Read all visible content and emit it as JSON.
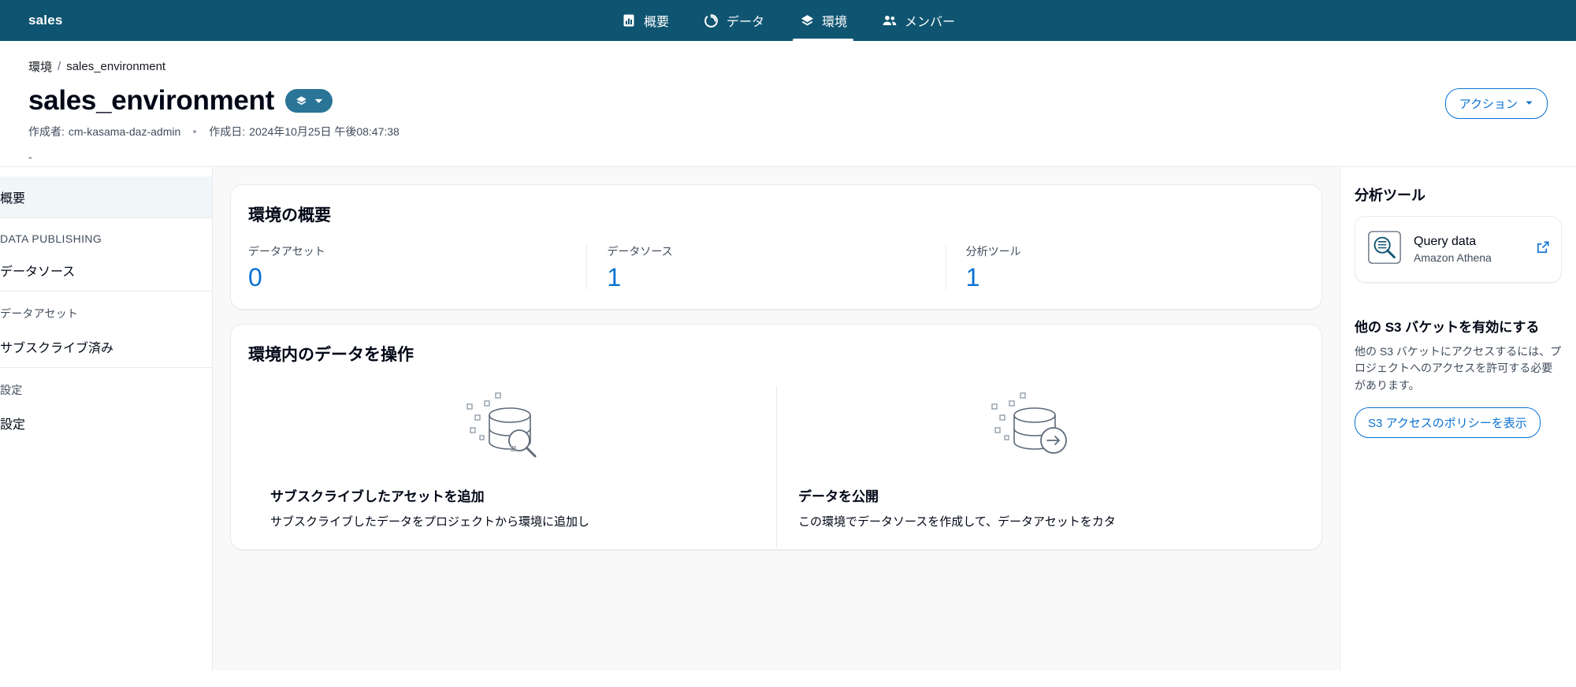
{
  "topnav": {
    "brand": "sales",
    "tabs": [
      {
        "label": "概要",
        "icon": "bar-chart-icon",
        "active": false
      },
      {
        "label": "データ",
        "icon": "donut-icon",
        "active": false
      },
      {
        "label": "環境",
        "icon": "layers-icon",
        "active": true
      },
      {
        "label": "メンバー",
        "icon": "people-icon",
        "active": false
      }
    ]
  },
  "breadcrumb": {
    "root": "環境",
    "separator": "/",
    "current": "sales_environment"
  },
  "header": {
    "title": "sales_environment",
    "pill_icon": "layers-icon",
    "pill_caret": "chevron-down-icon",
    "created_by_label": "作成者:",
    "created_by_value": "cm-kasama-daz-admin",
    "created_on_label": "作成日:",
    "created_on_value": "2024年10月25日 午後08:47:38",
    "description": "-",
    "actions_button": "アクション",
    "actions_caret": "caret-down-icon"
  },
  "sidebar": {
    "items": [
      {
        "label": "概要",
        "type": "item",
        "selected": true
      },
      {
        "label": "DATA PUBLISHING",
        "type": "heading"
      },
      {
        "label": "データソース",
        "type": "item",
        "selected": false
      },
      {
        "label": "データアセット",
        "type": "heading"
      },
      {
        "label": "サブスクライブ済み",
        "type": "item",
        "selected": false
      },
      {
        "label": "設定",
        "type": "heading"
      },
      {
        "label": "設定",
        "type": "item",
        "selected": false
      }
    ]
  },
  "overview_card": {
    "title": "環境の概要",
    "stats": [
      {
        "label": "データアセット",
        "value": "0"
      },
      {
        "label": "データソース",
        "value": "1"
      },
      {
        "label": "分析ツール",
        "value": "1"
      }
    ]
  },
  "work_card": {
    "title": "環境内のデータを操作",
    "tiles": [
      {
        "art": "database-search-icon",
        "title": "サブスクライブしたアセットを追加",
        "desc": "サブスクライブしたデータをプロジェクトから環境に追加し"
      },
      {
        "art": "database-arrow-icon",
        "title": "データを公開",
        "desc": "この環境でデータソースを作成して、データアセットをカタ"
      }
    ]
  },
  "rail": {
    "title": "分析ツール",
    "tool": {
      "icon": "athena-query-icon",
      "name": "Query data",
      "sub": "Amazon Athena",
      "external_icon": "external-link-icon"
    },
    "s3_section": {
      "heading": "他の S3 バケットを有効にする",
      "paragraph": "他の S3 バケットにアクセスするには、プロジェクトへのアクセスを許可する必要があります。",
      "button": "S3 アクセスのポリシーを表示"
    }
  },
  "colors": {
    "nav_bg": "#0f5571",
    "accent_link": "#0972d3",
    "pill_bg": "#2a7498",
    "selected_bg": "#f0f7f8",
    "page_bg": "#f9f9fa",
    "border": "#e9ebed"
  }
}
